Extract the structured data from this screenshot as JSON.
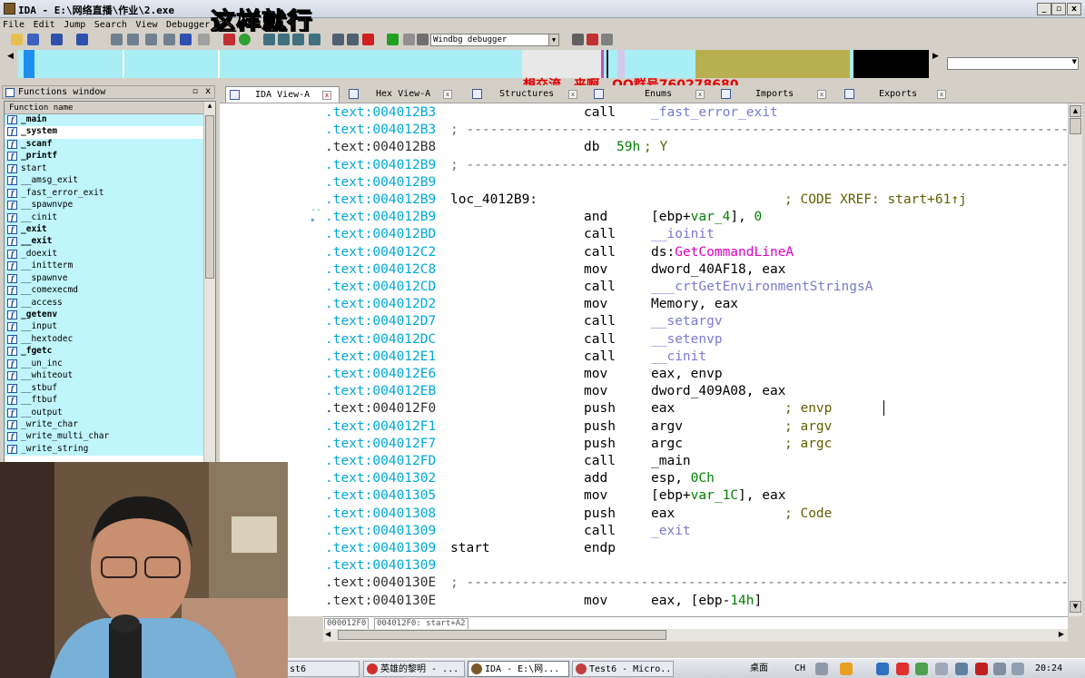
{
  "window": {
    "title": "IDA - E:\\网络直播\\作业\\2.exe",
    "min": "_",
    "max": "▫",
    "close": "x"
  },
  "overlay": {
    "caption": "这样就行",
    "qq_banner": "想交流，来啊，QQ群号760278680"
  },
  "menu": [
    "File",
    "Edit",
    "Jump",
    "Search",
    "View",
    "Debugger",
    "O"
  ],
  "toolbar": {
    "debugger_select": "Windbg debugger"
  },
  "colors": {
    "navbar_bg": "#a8eef4",
    "code_addr": "#00a8d8",
    "symbol": "#7a7ad0",
    "import": "#e000c0",
    "number": "#008000",
    "comment": "#606000",
    "overlay_red": "#e00000"
  },
  "functions_window": {
    "title": "Functions window",
    "column_header": "Function name",
    "items": [
      {
        "name": "_main",
        "bold": true,
        "selected": false
      },
      {
        "name": "_system",
        "bold": true,
        "selected": true
      },
      {
        "name": "_scanf",
        "bold": true,
        "selected": false
      },
      {
        "name": "_printf",
        "bold": true,
        "selected": false
      },
      {
        "name": "start",
        "bold": false,
        "selected": false
      },
      {
        "name": "__amsg_exit",
        "bold": false,
        "selected": false
      },
      {
        "name": "_fast_error_exit",
        "bold": false,
        "selected": false
      },
      {
        "name": "__spawnvpe",
        "bold": false,
        "selected": false
      },
      {
        "name": "__cinit",
        "bold": false,
        "selected": false
      },
      {
        "name": "_exit",
        "bold": true,
        "selected": false
      },
      {
        "name": "__exit",
        "bold": true,
        "selected": false
      },
      {
        "name": "_doexit",
        "bold": false,
        "selected": false
      },
      {
        "name": "__initterm",
        "bold": false,
        "selected": false
      },
      {
        "name": "__spawnve",
        "bold": false,
        "selected": false
      },
      {
        "name": "__comexecmd",
        "bold": false,
        "selected": false
      },
      {
        "name": "__access",
        "bold": false,
        "selected": false
      },
      {
        "name": "_getenv",
        "bold": true,
        "selected": false
      },
      {
        "name": "__input",
        "bold": false,
        "selected": false
      },
      {
        "name": "__hextodec",
        "bold": false,
        "selected": false
      },
      {
        "name": "_fgetc",
        "bold": true,
        "selected": false
      },
      {
        "name": "__un_inc",
        "bold": false,
        "selected": false
      },
      {
        "name": "__whiteout",
        "bold": false,
        "selected": false
      },
      {
        "name": "__stbuf",
        "bold": false,
        "selected": false
      },
      {
        "name": "__ftbuf",
        "bold": false,
        "selected": false
      },
      {
        "name": "__output",
        "bold": false,
        "selected": false
      },
      {
        "name": "_write_char",
        "bold": false,
        "selected": false
      },
      {
        "name": "_write_multi_char",
        "bold": false,
        "selected": false
      },
      {
        "name": "_write_string",
        "bold": false,
        "selected": false
      }
    ]
  },
  "tabs": [
    {
      "label": "IDA View-A",
      "active": true
    },
    {
      "label": "Hex View-A",
      "active": false
    },
    {
      "label": "Structures",
      "active": false
    },
    {
      "label": "Enums",
      "active": false
    },
    {
      "label": "Imports",
      "active": false
    },
    {
      "label": "Exports",
      "active": false
    }
  ],
  "code_lines": [
    {
      "addr": ".text:004012B3",
      "parts": [
        {
          "t": "call",
          "c": "mn",
          "col": 2
        },
        {
          "t": "_fast_error_exit",
          "c": "sym",
          "col": 3
        }
      ]
    },
    {
      "addr": ".text:004012B3",
      "sep": true
    },
    {
      "addr": ".text:004012B8",
      "dark": true,
      "parts": [
        {
          "t": "db",
          "c": "mn",
          "col": 2
        },
        {
          "t": "59h",
          "c": "num",
          "col": 2.5
        },
        {
          "t": "; Y",
          "c": "cmt",
          "col": 2.88
        }
      ]
    },
    {
      "addr": ".text:004012B9",
      "sep": true
    },
    {
      "addr": ".text:004012B9",
      "parts": []
    },
    {
      "addr": ".text:004012B9",
      "parts": [
        {
          "t": "loc_4012B9:",
          "c": "loc",
          "col": 1
        },
        {
          "t": "; CODE XREF: start+61↑j",
          "c": "cmt",
          "col": 4
        }
      ]
    },
    {
      "addr": ".text:004012B9",
      "parts": [
        {
          "t": "and",
          "c": "mn",
          "col": 2
        },
        {
          "t": "[ebp+var_4], 0",
          "c": "mixed",
          "col": 3,
          "html": "[ebp+<span class='num'>var_4</span>], <span class='num'>0</span>"
        }
      ]
    },
    {
      "addr": ".text:004012BD",
      "parts": [
        {
          "t": "call",
          "c": "mn",
          "col": 2
        },
        {
          "t": "__ioinit",
          "c": "sym",
          "col": 3
        }
      ]
    },
    {
      "addr": ".text:004012C2",
      "parts": [
        {
          "t": "call",
          "c": "mn",
          "col": 2
        },
        {
          "t": "ds:GetCommandLineA",
          "c": "mixed",
          "col": 3,
          "html": "ds:<span class='imp'>GetCommandLineA</span>"
        }
      ]
    },
    {
      "addr": ".text:004012C8",
      "parts": [
        {
          "t": "mov",
          "c": "mn",
          "col": 2
        },
        {
          "t": "dword_40AF18, eax",
          "c": "mn",
          "col": 3
        }
      ]
    },
    {
      "addr": ".text:004012CD",
      "parts": [
        {
          "t": "call",
          "c": "mn",
          "col": 2
        },
        {
          "t": "___crtGetEnvironmentStringsA",
          "c": "sym",
          "col": 3
        }
      ]
    },
    {
      "addr": ".text:004012D2",
      "parts": [
        {
          "t": "mov",
          "c": "mn",
          "col": 2
        },
        {
          "t": "Memory, eax",
          "c": "mn",
          "col": 3
        }
      ]
    },
    {
      "addr": ".text:004012D7",
      "parts": [
        {
          "t": "call",
          "c": "mn",
          "col": 2
        },
        {
          "t": "__setargv",
          "c": "sym",
          "col": 3
        }
      ]
    },
    {
      "addr": ".text:004012DC",
      "parts": [
        {
          "t": "call",
          "c": "mn",
          "col": 2
        },
        {
          "t": "__setenvp",
          "c": "sym",
          "col": 3
        }
      ]
    },
    {
      "addr": ".text:004012E1",
      "parts": [
        {
          "t": "call",
          "c": "mn",
          "col": 2
        },
        {
          "t": "__cinit",
          "c": "sym",
          "col": 3
        }
      ]
    },
    {
      "addr": ".text:004012E6",
      "parts": [
        {
          "t": "mov",
          "c": "mn",
          "col": 2
        },
        {
          "t": "eax, envp",
          "c": "mn",
          "col": 3
        }
      ]
    },
    {
      "addr": ".text:004012EB",
      "parts": [
        {
          "t": "mov",
          "c": "mn",
          "col": 2
        },
        {
          "t": "dword_409A08, eax",
          "c": "mn",
          "col": 3
        }
      ]
    },
    {
      "addr": ".text:004012F0",
      "dark": true,
      "parts": [
        {
          "t": "push",
          "c": "mn",
          "col": 2
        },
        {
          "t": "eax",
          "c": "mn",
          "col": 3
        },
        {
          "t": "; envp",
          "c": "cmt",
          "col": 4
        }
      ]
    },
    {
      "addr": ".text:004012F1",
      "parts": [
        {
          "t": "push",
          "c": "mn",
          "col": 2
        },
        {
          "t": "argv",
          "c": "mn",
          "col": 3
        },
        {
          "t": "; argv",
          "c": "cmt",
          "col": 4
        }
      ]
    },
    {
      "addr": ".text:004012F7",
      "parts": [
        {
          "t": "push",
          "c": "mn",
          "col": 2
        },
        {
          "t": "argc",
          "c": "mn",
          "col": 3
        },
        {
          "t": "; argc",
          "c": "cmt",
          "col": 4
        }
      ]
    },
    {
      "addr": ".text:004012FD",
      "parts": [
        {
          "t": "call",
          "c": "mn",
          "col": 2
        },
        {
          "t": "_main",
          "c": "mn",
          "col": 3
        }
      ]
    },
    {
      "addr": ".text:00401302",
      "parts": [
        {
          "t": "add",
          "c": "mn",
          "col": 2
        },
        {
          "t": "esp, 0Ch",
          "c": "mixed",
          "col": 3,
          "html": "esp, <span class='num'>0Ch</span>"
        }
      ]
    },
    {
      "addr": ".text:00401305",
      "parts": [
        {
          "t": "mov",
          "c": "mn",
          "col": 2
        },
        {
          "t": "[ebp+var_1C], eax",
          "c": "mixed",
          "col": 3,
          "html": "[ebp+<span class='num'>var_1C</span>], eax"
        }
      ]
    },
    {
      "addr": ".text:00401308",
      "parts": [
        {
          "t": "push",
          "c": "mn",
          "col": 2
        },
        {
          "t": "eax",
          "c": "mn",
          "col": 3
        },
        {
          "t": "; Code",
          "c": "cmt",
          "col": 4
        }
      ]
    },
    {
      "addr": ".text:00401309",
      "parts": [
        {
          "t": "call",
          "c": "mn",
          "col": 2
        },
        {
          "t": "_exit",
          "c": "sym",
          "col": 3
        }
      ]
    },
    {
      "addr": ".text:00401309",
      "parts": [
        {
          "t": "start",
          "c": "mn",
          "col": 1
        },
        {
          "t": "endp",
          "c": "mn",
          "col": 2
        }
      ]
    },
    {
      "addr": ".text:00401309",
      "parts": []
    },
    {
      "addr": ".text:0040130E",
      "dark": true,
      "sep": true
    },
    {
      "addr": ".text:0040130E",
      "dark": true,
      "parts": [
        {
          "t": "mov",
          "c": "mn",
          "col": 2
        },
        {
          "t": "eax, [ebp-14h]",
          "c": "mixed",
          "col": 3,
          "html": "eax, [ebp-<span class='num'>14h</span>]"
        }
      ]
    }
  ],
  "status": {
    "offset": "000012F0",
    "location": "004012F0: start+A2"
  },
  "taskbar": {
    "items": [
      {
        "label": "st6",
        "active": false
      },
      {
        "label": "英雄的黎明 - ...",
        "active": false
      },
      {
        "label": "IDA - E:\\网...",
        "active": true
      },
      {
        "label": "Test6 - Micro...",
        "active": false
      }
    ],
    "desktop": "桌面",
    "ime": "CH",
    "clock": "20:24"
  }
}
